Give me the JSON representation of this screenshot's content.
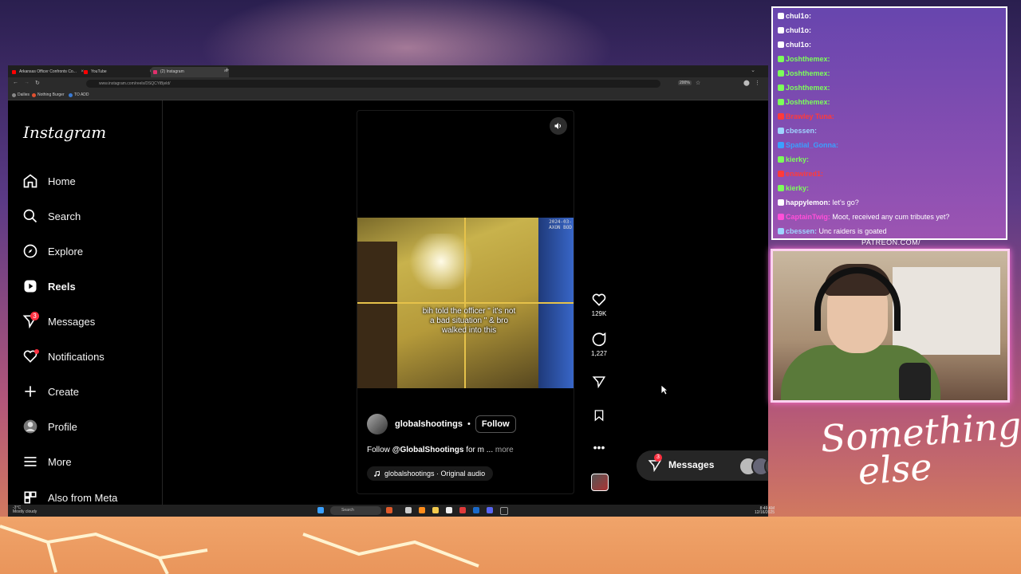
{
  "browser": {
    "tabs": [
      {
        "label": "Arkansas Officer Confronts Co...",
        "favicon_color": "#ff0000"
      },
      {
        "label": "YouTube",
        "favicon_color": "#ff0000"
      },
      {
        "label": "(2) Instagram",
        "favicon_color": "#e1306c",
        "active": true
      }
    ],
    "url": "www.instagram.com/reels/DSQCYiBjeld/",
    "zoom": "200%",
    "bookmarks": [
      {
        "label": "Dailies",
        "color": "#888888"
      },
      {
        "label": "Nothing Burger",
        "color": "#e05030"
      },
      {
        "label": "TO ADD",
        "color": "#3a7bd5"
      }
    ]
  },
  "instagram": {
    "logo": "Instagram",
    "nav": [
      {
        "id": "home",
        "label": "Home",
        "icon": "home-icon"
      },
      {
        "id": "search",
        "label": "Search",
        "icon": "search-icon"
      },
      {
        "id": "explore",
        "label": "Explore",
        "icon": "compass-icon"
      },
      {
        "id": "reels",
        "label": "Reels",
        "icon": "reels-icon",
        "bold": true
      },
      {
        "id": "messages",
        "label": "Messages",
        "icon": "messenger-icon",
        "badge": "3"
      },
      {
        "id": "notifications",
        "label": "Notifications",
        "icon": "heart-icon"
      },
      {
        "id": "create",
        "label": "Create",
        "icon": "plus-icon"
      },
      {
        "id": "profile",
        "label": "Profile",
        "icon": "avatar"
      },
      {
        "id": "more",
        "label": "More",
        "icon": "menu-icon"
      },
      {
        "id": "meta",
        "label": "Also from Meta",
        "icon": "meta-icon"
      }
    ],
    "reel": {
      "stamp_line1": "2024-03-",
      "stamp_line2": "AXON BOD",
      "caption": "bih told the officer \" it's not a bad situation \" & bro walked into this",
      "author": "globalshootings",
      "dot": "•",
      "follow": "Follow",
      "desc_prefix": "Follow ",
      "desc_tag": "@GlobalShootings",
      "desc_suffix": " for m ...",
      "desc_more": "more",
      "audio": "globalshootings · Original audio",
      "likes": "129K",
      "comments": "1,227"
    },
    "messages_pill": {
      "label": "Messages",
      "badge": "3"
    }
  },
  "taskbar": {
    "weather_temp": "-3°C",
    "weather_desc": "Mostly cloudy",
    "search": "Search",
    "time": "8:49 AM",
    "date": "12/16/2025"
  },
  "chat": [
    {
      "user": "chul1o:",
      "msg": "",
      "color": "#ffffff"
    },
    {
      "user": "chul1o:",
      "msg": "",
      "color": "#ffffff"
    },
    {
      "user": "chul1o:",
      "msg": "",
      "color": "#ffffff"
    },
    {
      "user": "Joshthemex:",
      "msg": "",
      "color": "#7cff5a"
    },
    {
      "user": "Joshthemex:",
      "msg": "",
      "color": "#7cff5a"
    },
    {
      "user": "Joshthemex:",
      "msg": "",
      "color": "#7cff5a"
    },
    {
      "user": "Joshthemex:",
      "msg": "",
      "color": "#7cff5a"
    },
    {
      "user": "Brawley Tuna:",
      "msg": "",
      "color": "#ff3a3a"
    },
    {
      "user": "cbessen:",
      "msg": "",
      "color": "#9fd4ff"
    },
    {
      "user": "Spatial_Gonna:",
      "msg": "",
      "color": "#3aa0ff"
    },
    {
      "user": "kierky:",
      "msg": "",
      "color": "#7cff5a"
    },
    {
      "user": "enawired1:",
      "msg": "",
      "color": "#ff3a3a"
    },
    {
      "user": "kierky:",
      "msg": "",
      "color": "#7cff5a"
    },
    {
      "user": "happylemon:",
      "msg": "let's go?",
      "color": "#ffffff"
    },
    {
      "user": "CaptainTwig:",
      "msg": "Moot, received any cum tributes yet?",
      "color": "#ff4fd8"
    },
    {
      "user": "cbessen:",
      "msg": "Unc raiders is goated",
      "color": "#9fd4ff"
    }
  ],
  "overlay": {
    "patreon": "PATREON.COM/",
    "brand": "Something else"
  }
}
